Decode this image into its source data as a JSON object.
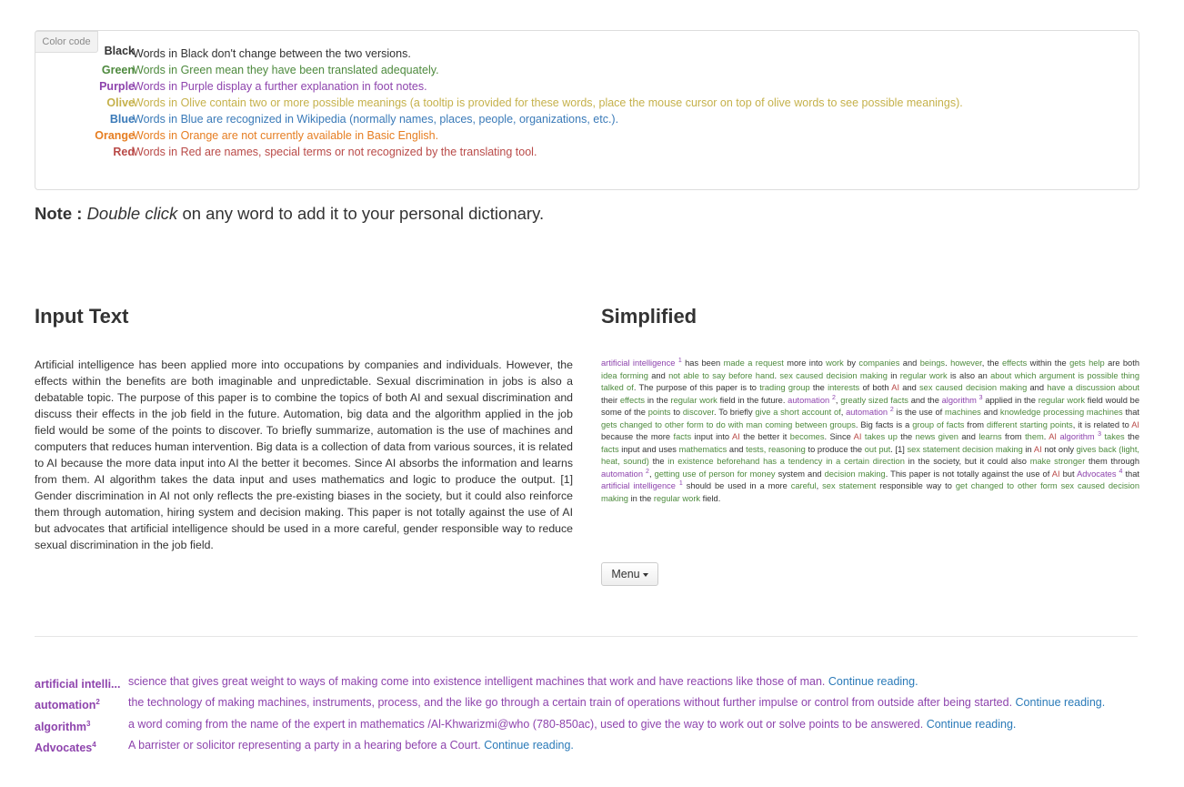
{
  "legend": {
    "tag": "Color code",
    "items": [
      {
        "name": "Black",
        "desc": "Words in Black don't change between the two versions.",
        "color": "#333333"
      },
      {
        "name": "Green",
        "desc": "Words in Green mean they have been translated adequately.",
        "color": "#4e8a3e"
      },
      {
        "name": "Purple",
        "desc": "Words in Purple display a further explanation in foot notes.",
        "color": "#8e44ad"
      },
      {
        "name": "Olive",
        "desc": "Words in Olive contain two or more possible meanings (a tooltip is provided for these words, place the mouse cursor on top of olive words to see possible meanings).",
        "color": "#c5b14b"
      },
      {
        "name": "Blue",
        "desc": "Words in Blue are recognized in Wikipedia (normally names, places, people, organizations, etc.).",
        "color": "#3a7ab8"
      },
      {
        "name": "Orange",
        "desc": "Words in Orange are not currently available in Basic English.",
        "color": "#e67e22"
      },
      {
        "name": "Red",
        "desc": "Words in Red are names, special terms or not recognized by the translating tool.",
        "color": "#b94a48"
      }
    ]
  },
  "note": {
    "label": "Note :",
    "emphasis": "Double click",
    "rest": " on any word to add it to your personal dictionary."
  },
  "input": {
    "heading": "Input Text",
    "text": "Artificial intelligence has been applied more into occupations by companies and individuals. However, the effects within the benefits are both imaginable and unpredictable. Sexual discrimination in jobs is also a debatable topic. The purpose of this paper is to combine the topics of both AI and sexual discrimination and discuss their effects in the job field in the future. Automation, big data and the algorithm applied in the job field would be some of the points to discover. To briefly summarize, automation is the use of machines and computers that reduces human intervention. Big data is a collection of data from various sources, it is related to AI because the more data input into AI the better it becomes. Since AI absorbs the information and learns from them. AI algorithm takes the data input and uses mathematics and logic to produce the output. [1] Gender discrimination in AI not only reflects the pre-existing biases in the society, but it could also reinforce them through automation, hiring system and decision making. This paper is not totally against the use of AI but advocates that artificial intelligence should be used in a more careful, gender responsible way to reduce sexual discrimination in the job field."
  },
  "simplified": {
    "heading": "Simplified",
    "tokens": [
      {
        "t": "artificial intelligence",
        "c": "purple"
      },
      {
        "t": " "
      },
      {
        "t": "1",
        "sup": true,
        "c": "purple"
      },
      {
        "t": " has been "
      },
      {
        "t": "made a request",
        "c": "green"
      },
      {
        "t": " more into "
      },
      {
        "t": "work",
        "c": "green"
      },
      {
        "t": " by "
      },
      {
        "t": "companies",
        "c": "green"
      },
      {
        "t": " and "
      },
      {
        "t": "beings",
        "c": "green"
      },
      {
        "t": ". "
      },
      {
        "t": "however",
        "c": "green"
      },
      {
        "t": ", the "
      },
      {
        "t": "effects",
        "c": "green"
      },
      {
        "t": " within the "
      },
      {
        "t": "gets help",
        "c": "green"
      },
      {
        "t": " are both "
      },
      {
        "t": "idea forming",
        "c": "green"
      },
      {
        "t": " and "
      },
      {
        "t": "not able to say before hand",
        "c": "green"
      },
      {
        "t": ". "
      },
      {
        "t": "sex caused decision making",
        "c": "green"
      },
      {
        "t": " in "
      },
      {
        "t": "regular work",
        "c": "green"
      },
      {
        "t": " is also an "
      },
      {
        "t": "about which argument is possible thing talked of",
        "c": "green"
      },
      {
        "t": ". The purpose of this paper is to "
      },
      {
        "t": "trading group",
        "c": "green"
      },
      {
        "t": " the "
      },
      {
        "t": "interests",
        "c": "green"
      },
      {
        "t": " of both "
      },
      {
        "t": "AI",
        "c": "red"
      },
      {
        "t": " and "
      },
      {
        "t": "sex caused decision making",
        "c": "green"
      },
      {
        "t": " and "
      },
      {
        "t": "have a discussion about",
        "c": "green"
      },
      {
        "t": " their "
      },
      {
        "t": "effects",
        "c": "green"
      },
      {
        "t": " in the "
      },
      {
        "t": "regular work",
        "c": "green"
      },
      {
        "t": " field in the future. "
      },
      {
        "t": "automation",
        "c": "purple"
      },
      {
        "t": " "
      },
      {
        "t": "2",
        "sup": true,
        "c": "purple"
      },
      {
        "t": ", "
      },
      {
        "t": "greatly sized facts",
        "c": "green"
      },
      {
        "t": " and the "
      },
      {
        "t": "algorithm",
        "c": "purple"
      },
      {
        "t": " "
      },
      {
        "t": "3",
        "sup": true,
        "c": "purple"
      },
      {
        "t": " applied in the "
      },
      {
        "t": "regular work",
        "c": "green"
      },
      {
        "t": " field would be some of the "
      },
      {
        "t": "points",
        "c": "green"
      },
      {
        "t": " to "
      },
      {
        "t": "discover",
        "c": "green"
      },
      {
        "t": ". To briefly "
      },
      {
        "t": "give a short account of",
        "c": "green"
      },
      {
        "t": ", "
      },
      {
        "t": "automation",
        "c": "purple"
      },
      {
        "t": " "
      },
      {
        "t": "2",
        "sup": true,
        "c": "purple"
      },
      {
        "t": " is the use of "
      },
      {
        "t": "machines",
        "c": "green"
      },
      {
        "t": " and "
      },
      {
        "t": "knowledge processing machines",
        "c": "green"
      },
      {
        "t": " that "
      },
      {
        "t": "gets changed to other form to do with man coming between groups",
        "c": "green"
      },
      {
        "t": ". Big facts is a "
      },
      {
        "t": "group of facts",
        "c": "green"
      },
      {
        "t": " from "
      },
      {
        "t": "different starting points",
        "c": "green"
      },
      {
        "t": ", it is related to "
      },
      {
        "t": "AI",
        "c": "red"
      },
      {
        "t": " because the more "
      },
      {
        "t": "facts",
        "c": "green"
      },
      {
        "t": " input into "
      },
      {
        "t": "AI",
        "c": "red"
      },
      {
        "t": " the better it "
      },
      {
        "t": "becomes",
        "c": "green"
      },
      {
        "t": ". Since "
      },
      {
        "t": "AI",
        "c": "red"
      },
      {
        "t": " "
      },
      {
        "t": "takes up",
        "c": "green"
      },
      {
        "t": " the "
      },
      {
        "t": "news given",
        "c": "green"
      },
      {
        "t": " and "
      },
      {
        "t": "learns",
        "c": "green"
      },
      {
        "t": " from "
      },
      {
        "t": "them",
        "c": "green"
      },
      {
        "t": ". "
      },
      {
        "t": "AI",
        "c": "red"
      },
      {
        "t": " "
      },
      {
        "t": "algorithm",
        "c": "purple"
      },
      {
        "t": " "
      },
      {
        "t": "3",
        "sup": true,
        "c": "purple"
      },
      {
        "t": " "
      },
      {
        "t": "takes",
        "c": "green"
      },
      {
        "t": " the "
      },
      {
        "t": "facts",
        "c": "green"
      },
      {
        "t": " input and uses "
      },
      {
        "t": "mathematics",
        "c": "green"
      },
      {
        "t": " and "
      },
      {
        "t": "tests, reasoning",
        "c": "green"
      },
      {
        "t": " to produce the "
      },
      {
        "t": "out put",
        "c": "green"
      },
      {
        "t": ". [1] "
      },
      {
        "t": "sex statement decision making",
        "c": "green"
      },
      {
        "t": " in "
      },
      {
        "t": "AI",
        "c": "red"
      },
      {
        "t": " not only "
      },
      {
        "t": "gives back (light, heat, sound)",
        "c": "green"
      },
      {
        "t": " the "
      },
      {
        "t": "in existence beforehand",
        "c": "green"
      },
      {
        "t": " "
      },
      {
        "t": "has a tendency in a certain direction",
        "c": "green"
      },
      {
        "t": " in the society, but it could also "
      },
      {
        "t": "make stronger",
        "c": "green"
      },
      {
        "t": " them through "
      },
      {
        "t": "automation",
        "c": "purple"
      },
      {
        "t": " "
      },
      {
        "t": "2",
        "sup": true,
        "c": "purple"
      },
      {
        "t": ", "
      },
      {
        "t": "getting use of person for money",
        "c": "green"
      },
      {
        "t": " system and "
      },
      {
        "t": "decision making",
        "c": "green"
      },
      {
        "t": ". This paper is not totally against the use of "
      },
      {
        "t": "AI",
        "c": "red"
      },
      {
        "t": " but "
      },
      {
        "t": "Advocates",
        "c": "purple"
      },
      {
        "t": " "
      },
      {
        "t": "4",
        "sup": true,
        "c": "purple"
      },
      {
        "t": " that "
      },
      {
        "t": "artificial intelligence",
        "c": "purple"
      },
      {
        "t": " "
      },
      {
        "t": "1",
        "sup": true,
        "c": "purple"
      },
      {
        "t": " should be used in a more "
      },
      {
        "t": "careful",
        "c": "green"
      },
      {
        "t": ", "
      },
      {
        "t": "sex statement",
        "c": "green"
      },
      {
        "t": " responsible way to "
      },
      {
        "t": "get changed to other form",
        "c": "green"
      },
      {
        "t": " "
      },
      {
        "t": "sex caused decision making",
        "c": "green"
      },
      {
        "t": " in the "
      },
      {
        "t": "regular work",
        "c": "green"
      },
      {
        "t": " field."
      }
    ]
  },
  "menu": {
    "label": "Menu"
  },
  "footnotes": [
    {
      "term": "artificial intelli...",
      "num": "",
      "def": "science that gives great weight to ways of making come into existence intelligent machines that work and have reactions like those of man.",
      "link": "Continue reading."
    },
    {
      "term": "automation",
      "num": "2",
      "def": "the technology of making machines, instruments, process, and the like go through a certain train of operations without further impulse or control from outside after being started.",
      "link": "Continue reading."
    },
    {
      "term": "algorithm",
      "num": "3",
      "def": "a word coming from the name of the expert in mathematics /Al-Khwarizmi@who (780-850ac), used to give the way to work out or solve points to be answered.",
      "link": "Continue reading."
    },
    {
      "term": "Advocates",
      "num": "4",
      "def": "A barrister or solicitor representing a party in a hearing before a Court.",
      "link": "Continue reading."
    }
  ]
}
